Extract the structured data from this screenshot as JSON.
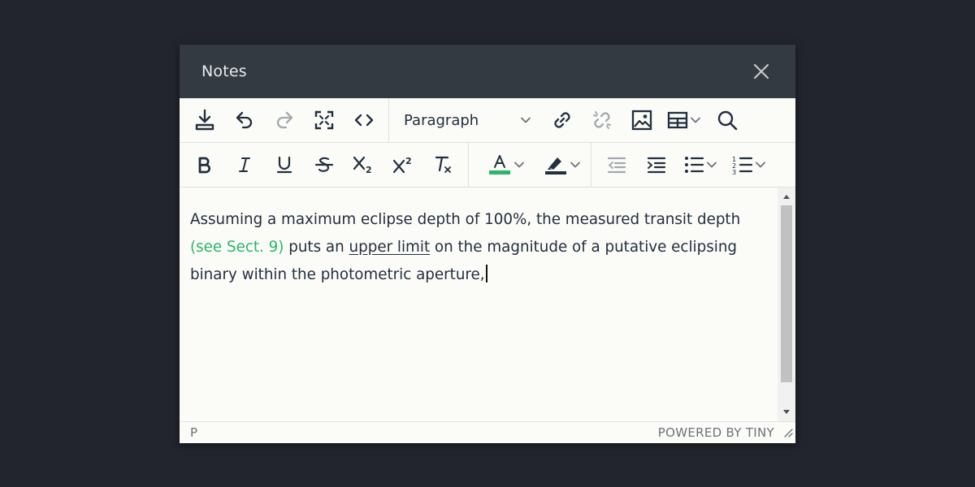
{
  "dialog": {
    "title": "Notes"
  },
  "toolbar": {
    "block_format": "Paragraph",
    "row1": [
      "save-icon",
      "undo-icon",
      "redo-icon",
      "fullscreen-icon",
      "code-view-icon",
      "link-icon",
      "unlink-icon",
      "image-icon",
      "table-icon",
      "search-icon"
    ],
    "row2": [
      "bold-icon",
      "italic-icon",
      "underline-icon",
      "strikethrough-icon",
      "subscript-icon",
      "superscript-icon",
      "clear-formatting-icon",
      "text-color-icon",
      "highlight-icon",
      "outdent-icon",
      "indent-icon",
      "bullet-list-icon",
      "numbered-list-icon"
    ]
  },
  "editor": {
    "text_1": "Assuming a maximum eclipse depth of 100%, the measured transit depth",
    "link_text": "(see Sect. 9)",
    "text_2": " puts an ",
    "underlined_text": "upper limit",
    "text_3": " on the magnitude of a putative eclipsing binary within the photometric aperture,"
  },
  "statusbar": {
    "path": "P",
    "brand": "POWERED BY TINY"
  },
  "colors": {
    "accent_green": "#2db56a",
    "titlebar": "#343a41",
    "background": "#22252d",
    "text": "#222f3e"
  }
}
